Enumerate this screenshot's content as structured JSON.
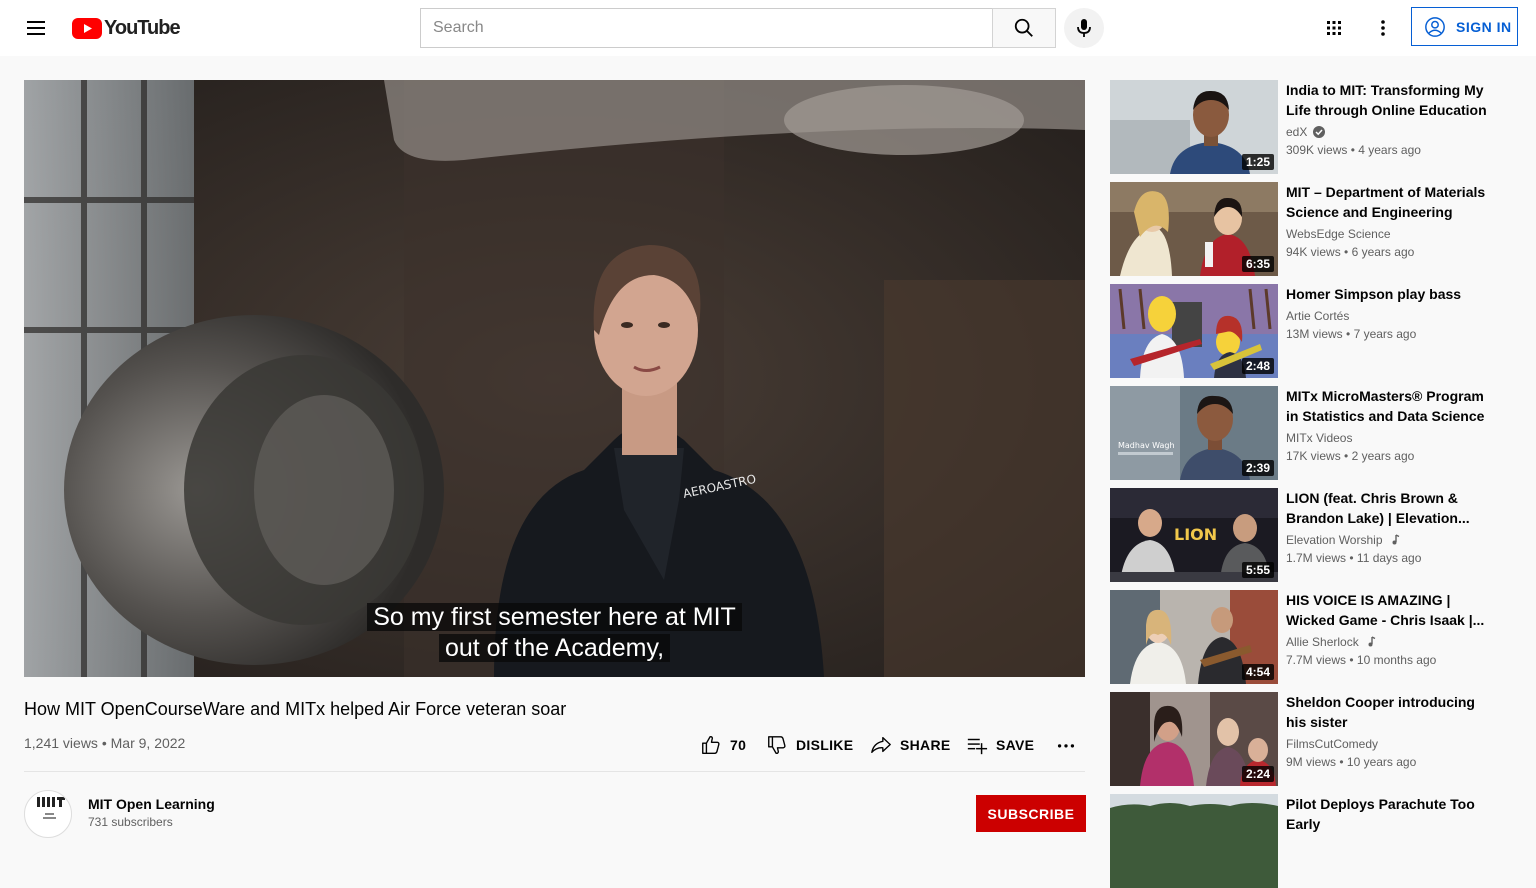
{
  "header": {
    "logo_text": "YouTube",
    "search_placeholder": "Search",
    "signin_label": "SIGN IN"
  },
  "player": {
    "caption_line1": "So my first semester here at MIT",
    "caption_line2": "out of the Academy,",
    "shirt_logo_text": "AEROASTRO"
  },
  "video": {
    "title": "How MIT OpenCourseWare and MITx helped Air Force veteran soar",
    "views": "1,241 views",
    "separator": "•",
    "date": "Mar 9, 2022",
    "like_count": "70",
    "dislike_label": "DISLIKE",
    "share_label": "SHARE",
    "save_label": "SAVE"
  },
  "channel": {
    "name": "MIT Open Learning",
    "subscribers": "731 subscribers",
    "subscribe_label": "SUBSCRIBE"
  },
  "recommendations": [
    {
      "title": "India to MIT: Transforming My Life through Online Education ...",
      "channel": "edX",
      "verified": true,
      "music": false,
      "views": "309K views",
      "age": "4 years ago",
      "duration": "1:25"
    },
    {
      "title": "MIT – Department of Materials Science and Engineering",
      "channel": "WebsEdge Science",
      "verified": false,
      "music": false,
      "views": "94K views",
      "age": "6 years ago",
      "duration": "6:35"
    },
    {
      "title": "Homer Simpson play bass",
      "channel": "Artie Cortés",
      "verified": false,
      "music": false,
      "views": "13M views",
      "age": "7 years ago",
      "duration": "2:48"
    },
    {
      "title": "MITx MicroMasters® Program in Statistics and Data Science ...",
      "channel": "MITx Videos",
      "verified": false,
      "music": false,
      "views": "17K views",
      "age": "2 years ago",
      "duration": "2:39",
      "thumb_text": "Madhav Wagh"
    },
    {
      "title": "LION (feat. Chris Brown & Brandon Lake) | Elevation...",
      "channel": "Elevation Worship",
      "verified": false,
      "music": true,
      "views": "1.7M views",
      "age": "11 days ago",
      "duration": "5:55",
      "thumb_text": "LION"
    },
    {
      "title": "HIS VOICE IS AMAZING | Wicked Game - Chris Isaak |...",
      "channel": "Allie Sherlock",
      "verified": false,
      "music": true,
      "views": "7.7M views",
      "age": "10 months ago",
      "duration": "4:54"
    },
    {
      "title": "Sheldon Cooper introducing his sister",
      "channel": "FilmsCutComedy",
      "verified": false,
      "music": false,
      "views": "9M views",
      "age": "10 years ago",
      "duration": "2:24"
    },
    {
      "title": "Pilot Deploys Parachute Too Early",
      "channel": "",
      "verified": false,
      "music": false,
      "views": "",
      "age": "",
      "duration": ""
    }
  ]
}
